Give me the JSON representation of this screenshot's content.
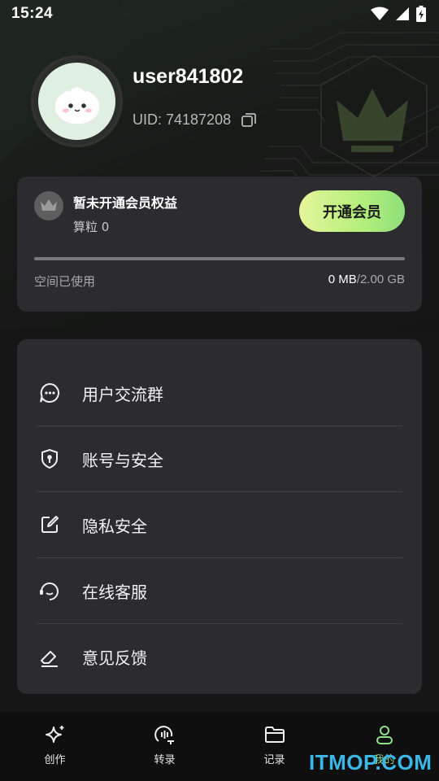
{
  "status_bar": {
    "time": "15:24",
    "icons": [
      "wifi-icon",
      "cellular-signal-icon",
      "battery-charging-icon"
    ]
  },
  "profile": {
    "username": "user841802",
    "uid_text": "UID: 74187208",
    "avatar": "steamed-bun-avatar",
    "copy_icon": "copy-icon"
  },
  "member_card": {
    "title": "暂未开通会员权益",
    "points": "算粒 0",
    "vip_button": "开通会员",
    "space_label": "空间已使用",
    "space_used": "0 MB",
    "space_total": "/2.00 GB",
    "space_used_fraction": 0
  },
  "menu": {
    "items": [
      {
        "label": "用户交流群",
        "icon": "chat-bubble-icon"
      },
      {
        "label": "账号与安全",
        "icon": "shield-lock-icon"
      },
      {
        "label": "隐私安全",
        "icon": "edit-note-icon"
      },
      {
        "label": "在线客服",
        "icon": "customer-service-icon"
      },
      {
        "label": "意见反馈",
        "icon": "eraser-feedback-icon"
      }
    ]
  },
  "bottom_nav": {
    "items": [
      {
        "label": "创作",
        "icon": "sparkle-icon",
        "active": false
      },
      {
        "label": "转录",
        "icon": "transcribe-icon",
        "active": false
      },
      {
        "label": "记录",
        "icon": "folder-icon",
        "active": false
      },
      {
        "label": "我的",
        "icon": "user-icon",
        "active": true
      }
    ]
  },
  "watermark": "ITMOP.COM",
  "colors": {
    "accent_green": "#b8f07c",
    "card_bg": "#2c2c30",
    "page_bg": "#161617",
    "watermark_blue": "#3bb8e8"
  }
}
